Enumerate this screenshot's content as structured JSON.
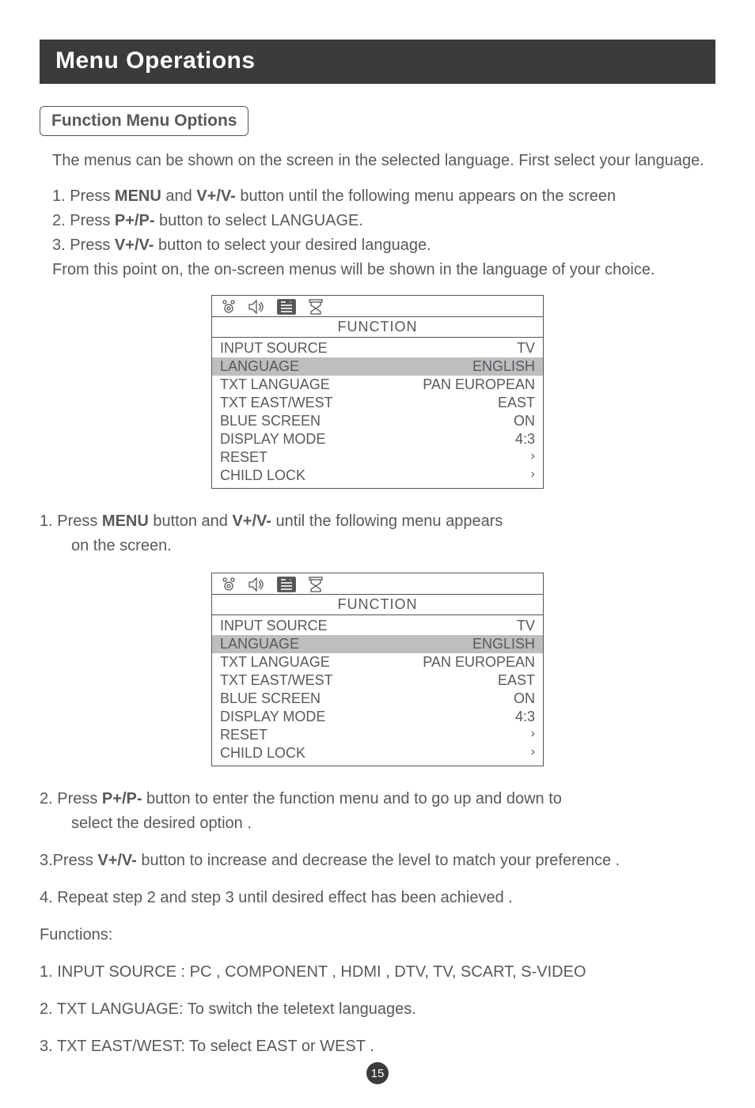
{
  "banner": "Menu Operations",
  "section_title": "Function Menu Options",
  "intro": "The menus can be shown on the screen in the selected language. First select your language.",
  "lang_steps": {
    "s1_a": "1. Press ",
    "s1_b": "MENU",
    "s1_c": " and ",
    "s1_d": "V+/V-",
    "s1_e": " button until the following menu appears on the screen",
    "s2_a": "2. Press ",
    "s2_b": "P+/P-",
    "s2_c": " button to select LANGUAGE.",
    "s3_a": "3. Press ",
    "s3_b": "V+/V-",
    "s3_c": " button to select your desired language.",
    "after": "From this point on, the on-screen menus will be shown in the language of your choice."
  },
  "osd1": {
    "title": "FUNCTION",
    "rows": [
      {
        "label": "INPUT SOURCE",
        "value": "TV"
      },
      {
        "label": "LANGUAGE",
        "value": "ENGLISH",
        "hl": true
      },
      {
        "label": "TXT LANGUAGE",
        "value": "PAN EUROPEAN"
      },
      {
        "label": "TXT EAST/WEST",
        "value": "EAST"
      },
      {
        "label": "BLUE SCREEN",
        "value": "ON"
      },
      {
        "label": "DISPLAY MODE",
        "value": "4:3"
      },
      {
        "label": "RESET",
        "value": "chev"
      },
      {
        "label": "CHILD LOCK",
        "value": "chev"
      }
    ]
  },
  "main_steps": {
    "s1_a": "1. Press ",
    "s1_b": "MENU",
    "s1_c": " button and ",
    "s1_d": "V+/V-",
    "s1_e": " until the following menu appears",
    "s1_f": "on the screen.",
    "s2_a": "2. Press ",
    "s2_b": "P+/P-",
    "s2_c": " button to enter the function menu and to go up and down to",
    "s2_d": "select the desired option .",
    "s3_a": "3.Press ",
    "s3_b": "V+/V-",
    "s3_c": " button to increase and decrease the level to match your preference .",
    "s4": "4. Repeat step 2 and step 3 until desired effect has been achieved ."
  },
  "functions": {
    "heading": "Functions:",
    "f1": "1. INPUT SOURCE : PC , COMPONENT , HDMI , DTV, TV, SCART, S-VIDEO",
    "f2": "2. TXT LANGUAGE: To switch the teletext languages.",
    "f3": "3. TXT EAST/WEST: To select EAST or WEST ."
  },
  "page_number": "15",
  "chev_glyph": "›"
}
